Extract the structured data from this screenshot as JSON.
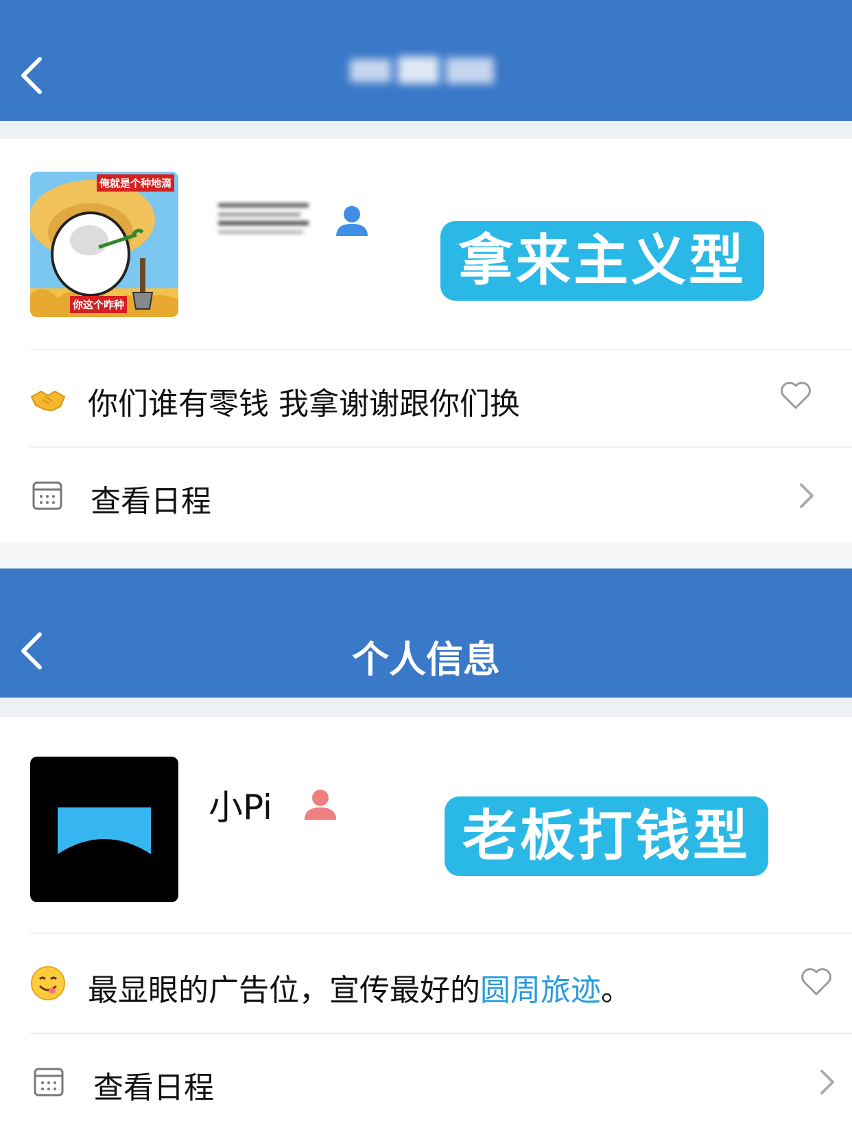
{
  "colors": {
    "header_bg": "#3a78c8",
    "tag_bg": "#2ab8e6",
    "link": "#2a9be0",
    "user_icon_blue": "#3f8fe6",
    "user_icon_red": "#f08080"
  },
  "panel1": {
    "avatar_caption_top": "俺就是个种地滴",
    "avatar_caption_bottom": "你这个咋种",
    "tag": "拿来主义型",
    "status_emoji": "handshake-icon",
    "status": "你们谁有零钱 我拿谢谢跟你们换",
    "schedule_label": "查看日程"
  },
  "panel2": {
    "header_title": "个人信息",
    "name": "小Pi",
    "tag": "老板打钱型",
    "status_emoji": "yum-face-icon",
    "status_prefix": "最显眼的广告位，宣传最好的",
    "status_link": "圆周旅迹",
    "status_suffix": "。",
    "schedule_label": "查看日程"
  }
}
